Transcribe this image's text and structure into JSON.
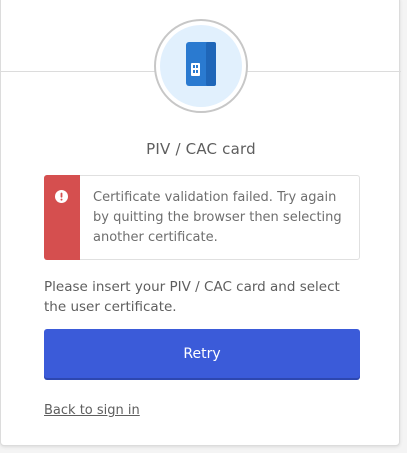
{
  "factor": {
    "title": "PIV / CAC card",
    "logo_icon": "smart-card-icon"
  },
  "alert": {
    "type": "error",
    "icon": "exclamation-circle-icon",
    "message": "Certificate validation failed. Try again by quitting the browser then selecting another certificate.",
    "stripe_color": "#d54f4f"
  },
  "instructions": "Please insert your PIV / CAC card and select the user certificate.",
  "retry_button": {
    "label": "Retry",
    "color": "#3b5bd9"
  },
  "back_link": {
    "label": "Back to sign in"
  }
}
